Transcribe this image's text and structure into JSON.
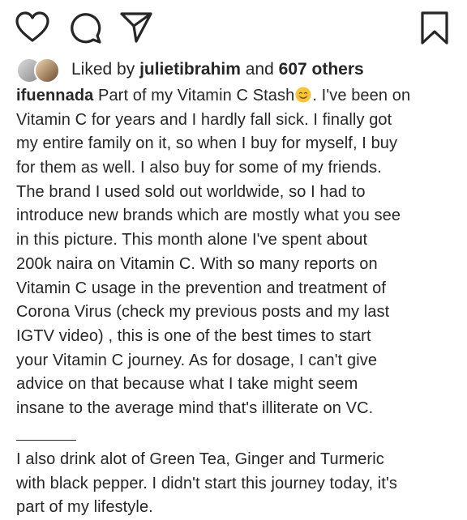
{
  "actions": {
    "like_icon": "heart-outline",
    "comment_icon": "comment-bubble",
    "share_icon": "paper-plane",
    "save_icon": "bookmark-outline"
  },
  "likes": {
    "prefix": "Liked by ",
    "user": "julietibrahim",
    "middle": " and ",
    "others": "607 others"
  },
  "caption": {
    "username": "ifuennada",
    "line1_a": " Part of my Vitamin C Stash",
    "emoji": "smiling-face-emoji",
    "line1_b": ". I've been on",
    "lines": [
      "Vitamin C for years and I hardly fall sick. I finally got",
      "my entire family on it, so when I buy for myself, I buy",
      "for them as well. I also buy for some of my friends.",
      "The brand I used sold out worldwide, so I had to",
      "introduce new brands which are mostly what you see",
      "in this picture. This month alone I've spent about",
      "200k naira on Vitamin C. With so many reports on",
      "Vitamin C usage in the prevention and treatment of",
      "Corona Virus (check my previous posts and my last",
      "IGTV video) , this is one of the best times to start",
      "your Vitamin C journey. As for dosage, I can't give",
      "advice on that because what I take might seem",
      "insane to the average mind that's illiterate on VC."
    ],
    "lines2": [
      "I also drink alot of Green Tea, Ginger and Turmeric",
      "with black pepper. I didn't start this journey today, it's",
      "part of my lifestyle."
    ]
  },
  "colors": {
    "text": "#262626",
    "background": "#ffffff",
    "emoji": "#f7c531"
  }
}
